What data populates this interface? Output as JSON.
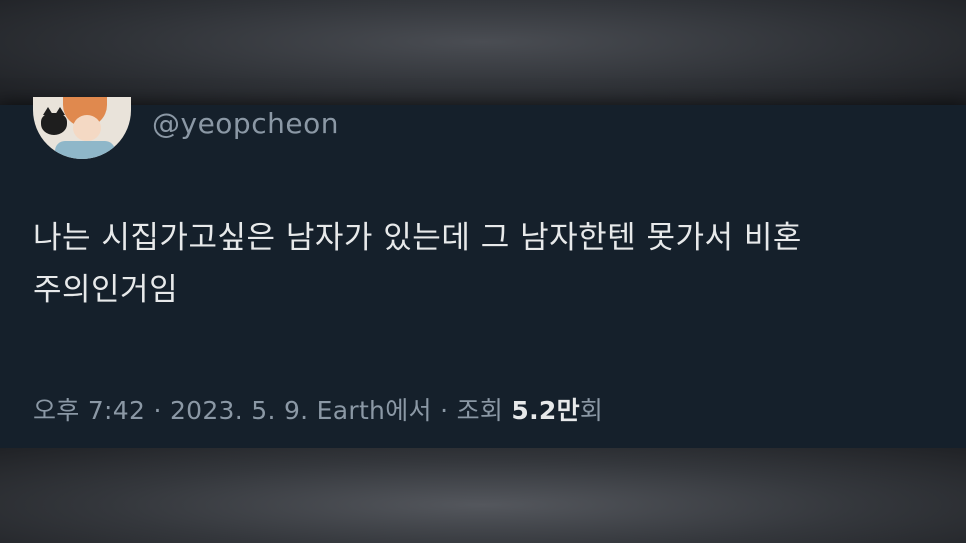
{
  "tweet": {
    "handle": "@yeopcheon",
    "text_line1": "나는 시집가고싶은 남자가 있는데 그 남자한텐 못가서 비혼",
    "text_line2": "주의인거임",
    "meta": {
      "time": "오후 7:42",
      "separator": "·",
      "date": "2023. 5. 9.",
      "location": "Earth에서",
      "views_label": "조회",
      "views_count": "5.2만",
      "views_suffix": "회"
    }
  },
  "colors": {
    "background": "#15202b",
    "text_primary": "#e7e9ea",
    "text_secondary": "#8b98a5"
  },
  "icons": {
    "avatar": "profile-avatar-illustration"
  }
}
